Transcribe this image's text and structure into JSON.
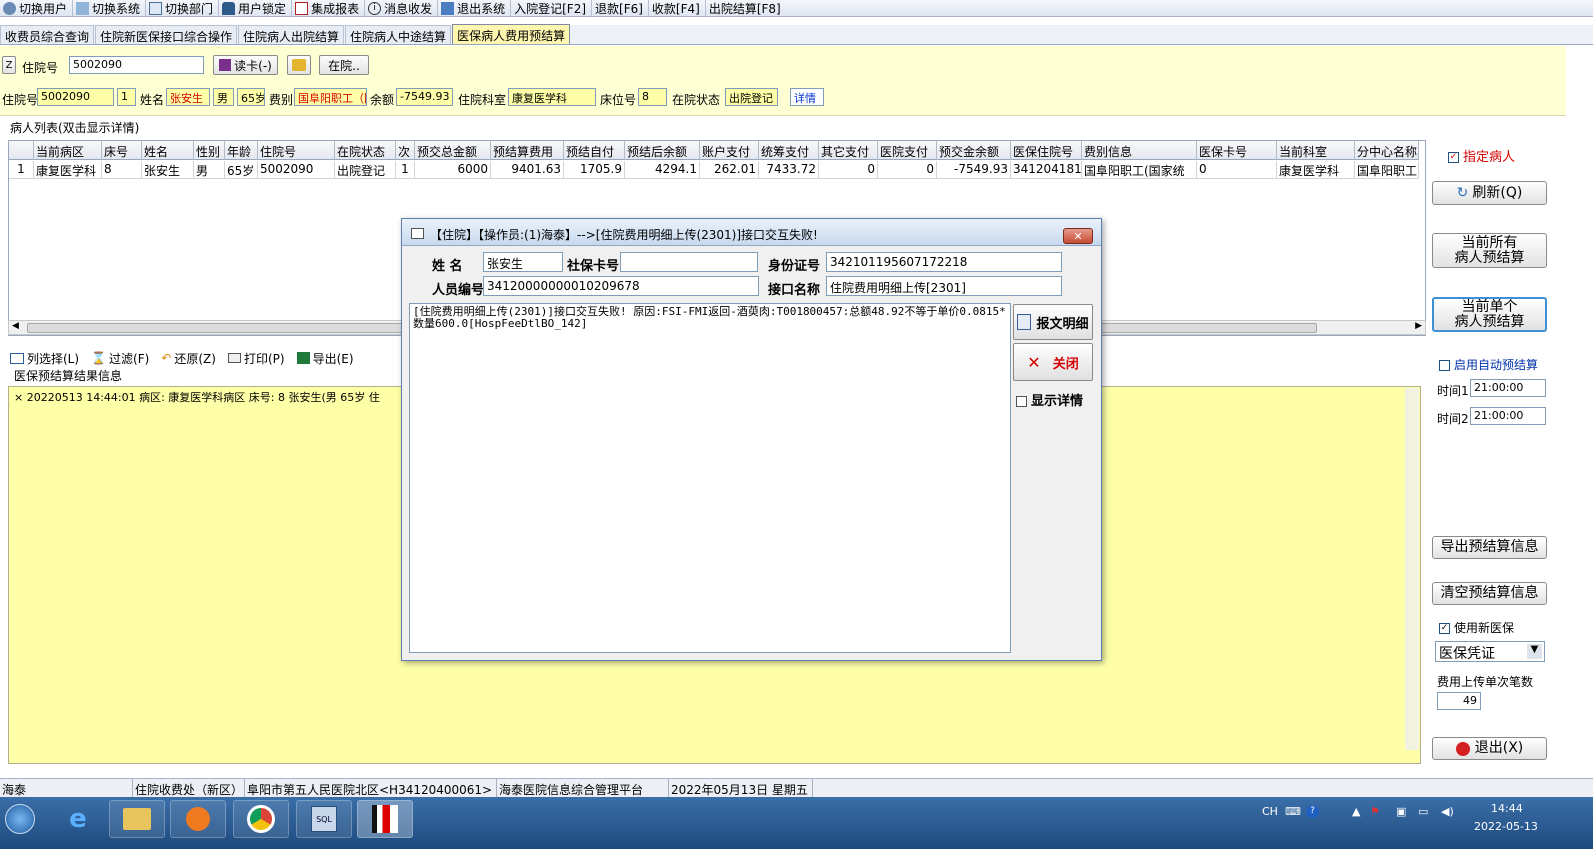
{
  "toolbar": [
    {
      "label": "切换用户",
      "icon": "switch-user-icon"
    },
    {
      "label": "切换系统",
      "icon": "switch-system-icon"
    },
    {
      "label": "切换部门",
      "icon": "switch-dept-icon"
    },
    {
      "label": "用户锁定",
      "icon": "lock-icon"
    },
    {
      "label": "集成报表",
      "icon": "report-icon"
    },
    {
      "label": "消息收发",
      "icon": "info-icon"
    },
    {
      "label": "退出系统",
      "icon": "exit-icon"
    },
    {
      "label": "入院登记[F2]"
    },
    {
      "label": "退款[F6]"
    },
    {
      "label": "收款[F4]"
    },
    {
      "label": "出院结算[F8]"
    }
  ],
  "tabs": [
    "收费员综合查询",
    "住院新医保接口综合操作",
    "住院病人出院结算",
    "住院病人中途结算",
    "医保病人费用预结算"
  ],
  "search": {
    "z_label": "Z",
    "admission_label": "住院号",
    "admission_value": "5002090",
    "read_card": "读卡(-)",
    "in_hospital": "在院.."
  },
  "patient": {
    "admission_label": "住院号",
    "admission_no": "5002090",
    "times": "1",
    "name_label": "姓名",
    "name": "张安生",
    "gender": "男",
    "age": "65岁",
    "fee_label": "费别",
    "fee_type": "国阜阳职工（国",
    "balance_label": "余额",
    "balance": "-7549.93",
    "dept_label": "住院科室",
    "dept": "康复医学科",
    "bed_label": "床位号",
    "bed": "8",
    "status_label": "在院状态",
    "status": "出院登记",
    "detail_link": "详情"
  },
  "list": {
    "title": "病人列表(双击显示详情)",
    "columns": [
      "",
      "当前病区",
      "床号",
      "姓名",
      "性别",
      "年龄",
      "住院号",
      "在院状态",
      "次",
      "预交总金额",
      "预结算费用",
      "预结自付",
      "预结后余额",
      "账户支付",
      "统筹支付",
      "其它支付",
      "医院支付",
      "预交金余额",
      "医保住院号",
      "费别信息",
      "医保卡号",
      "当前科室",
      "分中心名称"
    ],
    "rows": [
      [
        "1",
        "康复医学科",
        "8",
        "张安生",
        "男",
        "65岁",
        "5002090",
        "出院登记",
        "1",
        "6000",
        "9401.63",
        "1705.9",
        "4294.1",
        "262.01",
        "7433.72",
        "0",
        "0",
        "-7549.93",
        "3412041813",
        "国阜阳职工(国家统",
        "0",
        "康复医学科",
        "国阜阳职工"
      ]
    ]
  },
  "subtoolbar": [
    "列选择(L)",
    "过滤(F)",
    "还原(Z)",
    "打印(P)",
    "导出(E)"
  ],
  "result": {
    "title": "医保预结算结果信息",
    "line": "× 20220513 14:44:01 病区: 康复医学科病区 床号: 8 张安生(男 65岁 住"
  },
  "right_panel": {
    "designated_patient": "指定病人",
    "refresh": "刷新(Q)",
    "all_presettle": "当前所有\n病人预结算",
    "single_presettle": "当前单个\n病人预结算",
    "auto_presettle": "启用自动预结算",
    "time1_label": "时间1",
    "time1": "21:00:00",
    "time2_label": "时间2",
    "time2": "21:00:00",
    "export_info": "导出预结算信息",
    "clear_info": "清空预结算信息",
    "use_new_insurance": "使用新医保",
    "voucher": "医保凭证",
    "batch_label": "费用上传单次笔数",
    "batch_value": "49",
    "exit": "退出(X)"
  },
  "dialog": {
    "title": "【住院】【操作员:(1)海泰】-->[住院费用明细上传(2301)]接口交互失败!",
    "name_label": "姓  名",
    "name": "张安生",
    "card_label": "社保卡号",
    "card": "",
    "id_label": "身份证号",
    "id": "342101195607172218",
    "person_label": "人员编号",
    "person": "34120000000010209678",
    "iface_label": "接口名称",
    "iface": "住院费用明细上传[2301]",
    "message": "[住院费用明细上传(2301)]接口交互失败! 原因:FSI-FMI返回-酒萸肉:T001800457:总额48.92不等于单价0.0815*数量600.0[HospFeeDtlBO_142]",
    "btn_detail": "报文明细",
    "btn_close": "关闭",
    "show_detail": "显示详情"
  },
  "statusbar": [
    "海泰",
    "住院收费处（新区）",
    "阜阳市第五人民医院北区<H34120400061>",
    "海泰医院信息综合管理平台",
    "2022年05月13日 星期五"
  ],
  "taskbar": {
    "ime": "CH",
    "time": "14:44",
    "date": "2022-05-13"
  }
}
